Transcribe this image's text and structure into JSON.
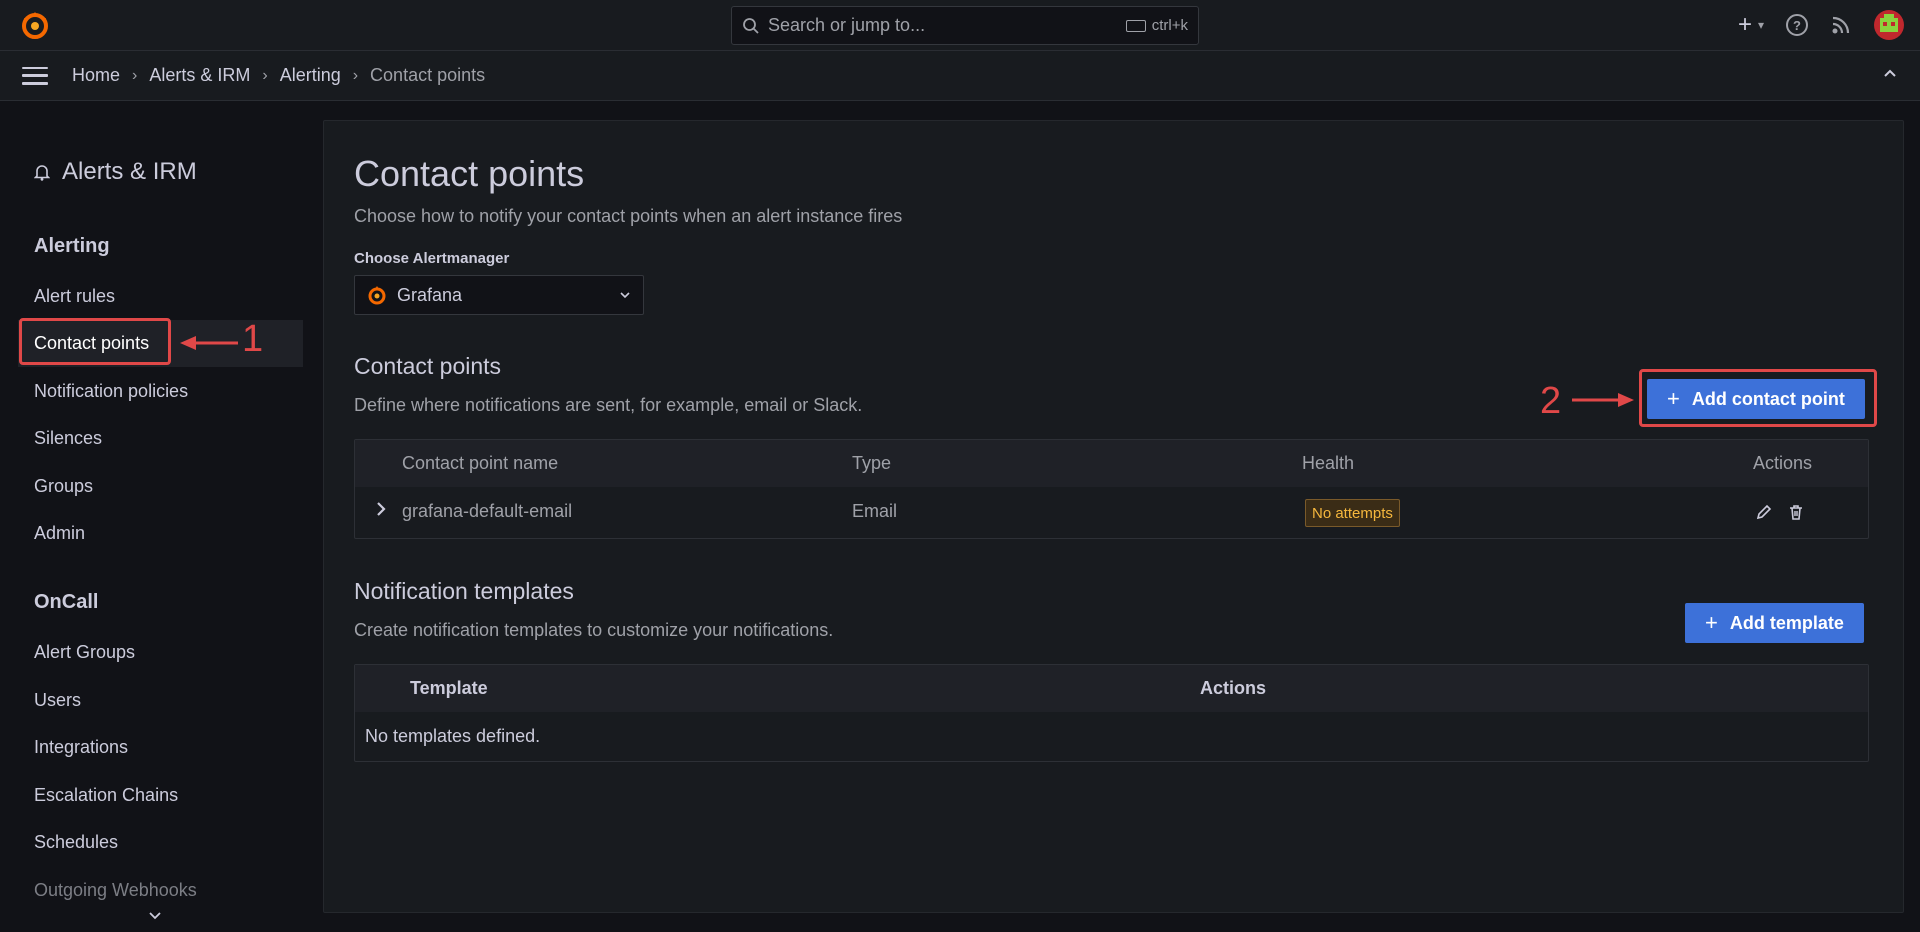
{
  "topbar": {
    "search_placeholder": "Search or jump to...",
    "shortcut": "ctrl+k",
    "plus_label": "+",
    "help_glyph": "?"
  },
  "breadcrumb": {
    "items": [
      "Home",
      "Alerts & IRM",
      "Alerting",
      "Contact points"
    ]
  },
  "sidebar": {
    "title": "Alerts & IRM",
    "alerting_section": "Alerting",
    "alerting_items": [
      "Alert rules",
      "Contact points",
      "Notification policies",
      "Silences",
      "Groups",
      "Admin"
    ],
    "oncall_section": "OnCall",
    "oncall_items": [
      "Alert Groups",
      "Users",
      "Integrations",
      "Escalation Chains",
      "Schedules",
      "Outgoing Webhooks"
    ]
  },
  "main": {
    "title": "Contact points",
    "subtitle": "Choose how to notify your contact points when an alert instance fires",
    "alertmanager_label": "Choose Alertmanager",
    "alertmanager_value": "Grafana",
    "contact_points": {
      "title": "Contact points",
      "subtitle": "Define where notifications are sent, for example, email or Slack.",
      "add_button": "Add contact point",
      "headers": [
        "Contact point name",
        "Type",
        "Health",
        "Actions"
      ],
      "rows": [
        {
          "name": "grafana-default-email",
          "type": "Email",
          "health": "No attempts"
        }
      ]
    },
    "templates": {
      "title": "Notification templates",
      "subtitle": "Create notification templates to customize your notifications.",
      "add_button": "Add template",
      "headers": [
        "Template",
        "Actions"
      ],
      "empty": "No templates defined."
    }
  },
  "annotations": {
    "one": "1",
    "two": "2"
  },
  "colors": {
    "primary": "#3d71d9",
    "annotation": "#e04848",
    "warning": "#f5b73d"
  }
}
